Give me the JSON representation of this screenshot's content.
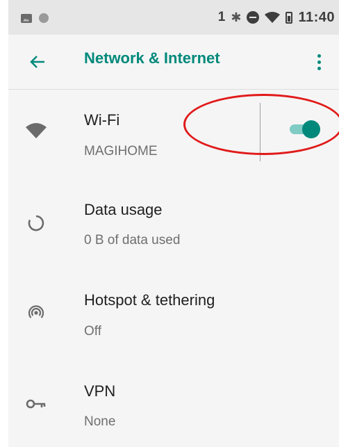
{
  "status_bar": {
    "left_icons": [
      "image-icon",
      "circle-icon"
    ],
    "sim_number": "1",
    "right_icons": [
      "bluetooth-icon",
      "do-not-disturb-icon",
      "wifi-icon",
      "battery-icon"
    ],
    "time": "11:40"
  },
  "app_bar": {
    "title": "Network & Internet",
    "back_icon": "arrow-back-icon",
    "menu_icon": "more-vert-icon"
  },
  "items": [
    {
      "title": "Wi-Fi",
      "summary": "MAGIHOME",
      "icon": "wifi-icon",
      "toggle_on": true
    },
    {
      "title": "Data usage",
      "summary": "0 B of data used",
      "icon": "data-usage-icon"
    },
    {
      "title": "Hotspot & tethering",
      "summary": "Off",
      "icon": "hotspot-icon"
    },
    {
      "title": "VPN",
      "summary": "None",
      "icon": "vpn-key-icon"
    }
  ],
  "colors": {
    "accent": "#00897b",
    "accent_light": "#80cbc4",
    "status_bar_bg": "#e6e6e6",
    "background": "#f5f5f5",
    "annotation": "#e11a1a"
  }
}
